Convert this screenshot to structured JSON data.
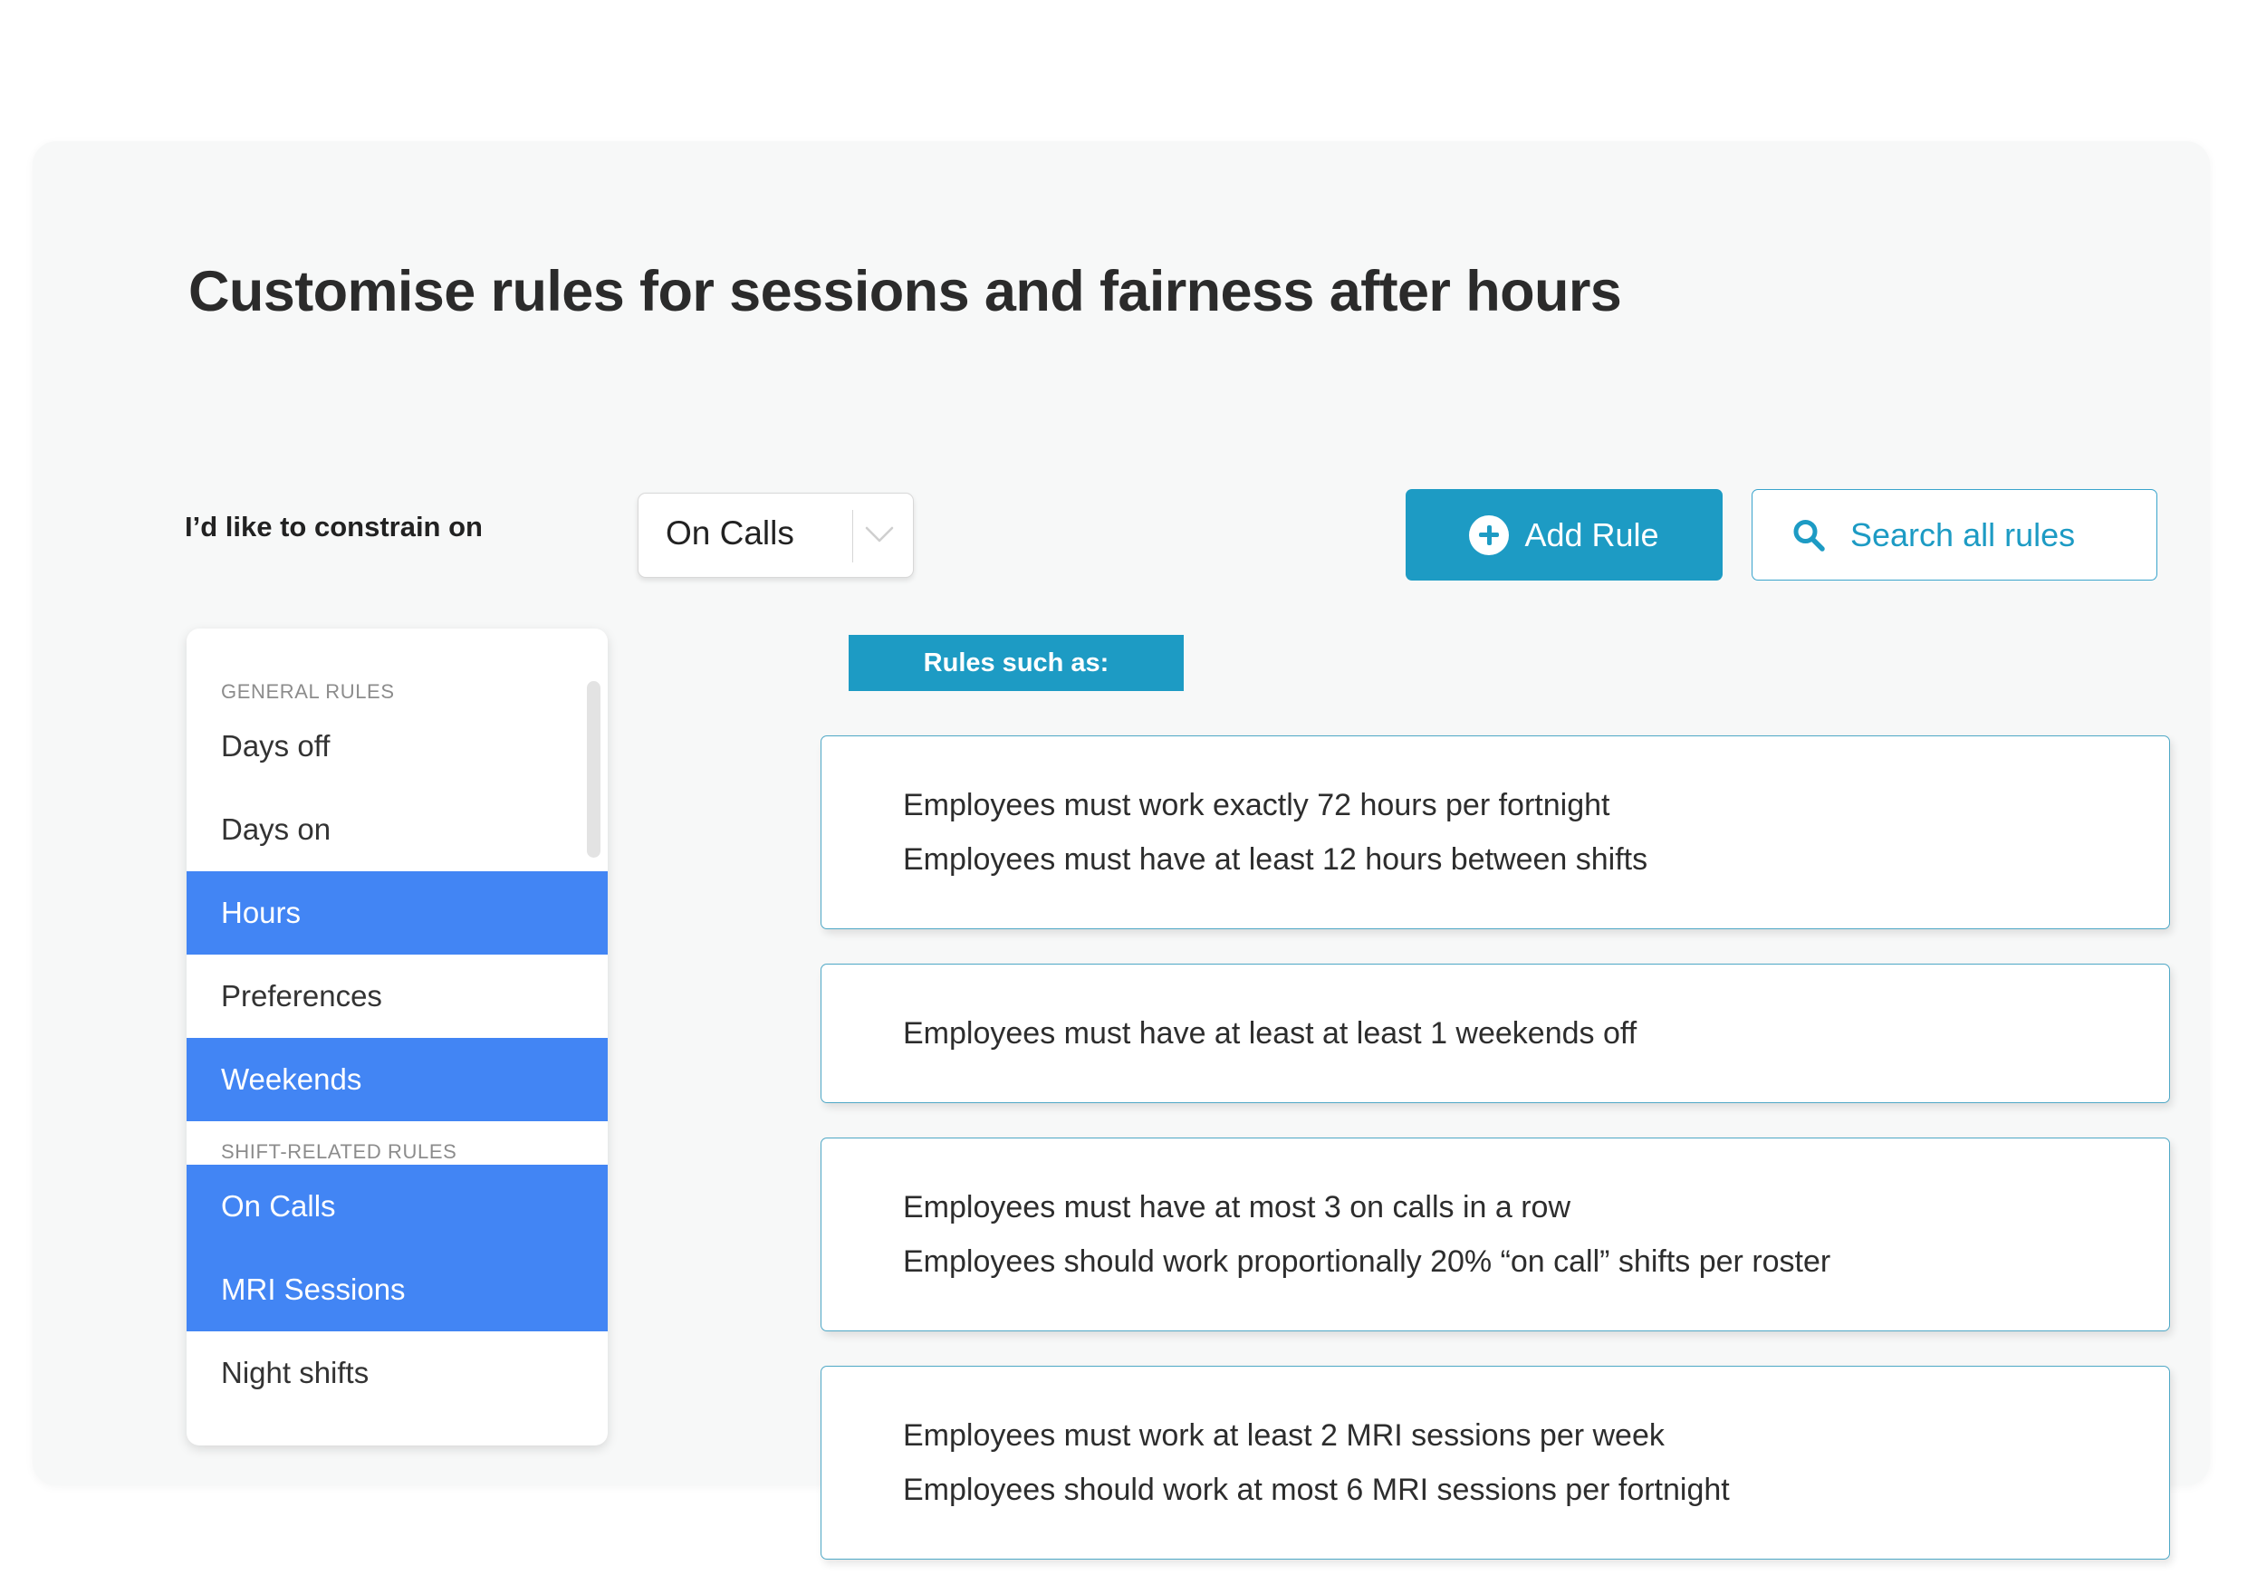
{
  "colors": {
    "accent_teal": "#1d9bc4",
    "selected_blue": "#4285f4",
    "card_border": "#4fa8c6",
    "panel_bg": "#f7f8f8"
  },
  "page": {
    "title": "Customise rules for sessions and fairness after hours"
  },
  "controls": {
    "constrain_label": "I’d like to constrain on",
    "dropdown": {
      "name": "constrain-on-select",
      "value": "On Calls",
      "chevron_icon": "chevron-down-icon"
    },
    "add_rule": {
      "label": "Add Rule",
      "icon": "plus-circle-icon"
    },
    "search": {
      "label": "Search all rules",
      "icon": "search-icon"
    }
  },
  "sidebar": {
    "scrollbar": "vertical-scrollbar",
    "groups": [
      {
        "header": "GENERAL RULES",
        "items": [
          {
            "label": "Days off",
            "selected": false
          },
          {
            "label": "Days on",
            "selected": false
          },
          {
            "label": "Hours",
            "selected": true
          },
          {
            "label": "Preferences",
            "selected": false
          },
          {
            "label": "Weekends",
            "selected": true
          }
        ]
      },
      {
        "header": "SHIFT-RELATED RULES",
        "items": [
          {
            "label": "On Calls",
            "selected": true
          },
          {
            "label": "MRI Sessions",
            "selected": true
          },
          {
            "label": "Night shifts",
            "selected": false
          }
        ]
      }
    ]
  },
  "main": {
    "badge_label": "Rules such as:",
    "cards": [
      {
        "lines": [
          "Employees must work exactly 72 hours per fortnight",
          "Employees must have at least 12 hours between shifts"
        ]
      },
      {
        "lines": [
          "Employees must have at least at least 1 weekends off"
        ]
      },
      {
        "lines": [
          "Employees must have at most 3 on calls in a row",
          "Employees should work proportionally 20% “on call” shifts per roster"
        ]
      },
      {
        "lines": [
          "Employees must work at least 2 MRI sessions per week",
          "Employees should work at most 6 MRI sessions per fortnight"
        ]
      }
    ]
  }
}
